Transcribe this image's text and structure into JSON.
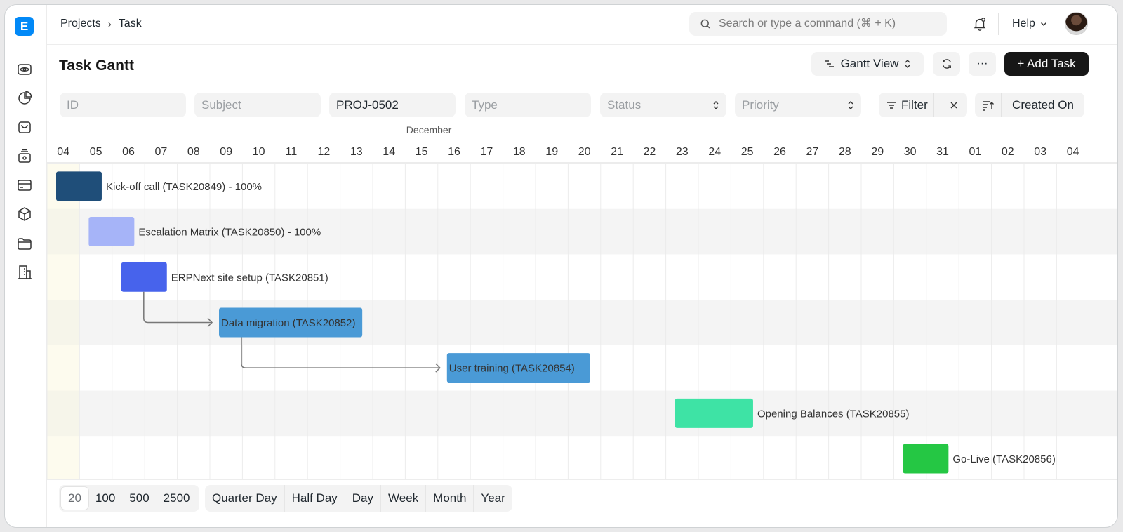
{
  "app": {
    "logo_letter": "E"
  },
  "breadcrumb": [
    "Projects",
    "Task"
  ],
  "search": {
    "placeholder": "Search or type a command (⌘ + K)"
  },
  "topbar": {
    "help_label": "Help"
  },
  "page": {
    "title": "Task Gantt"
  },
  "actions": {
    "view_label": "Gantt View",
    "add_label": "+ Add Task",
    "more_label": "···"
  },
  "filters": {
    "id_placeholder": "ID",
    "subject_placeholder": "Subject",
    "project_value": "PROJ-0502",
    "type_placeholder": "Type",
    "status_placeholder": "Status",
    "priority_placeholder": "Priority",
    "filter_label": "Filter",
    "sort_label": "Created On"
  },
  "gantt": {
    "month_label": "December",
    "days": [
      "04",
      "05",
      "06",
      "07",
      "08",
      "09",
      "10",
      "11",
      "12",
      "13",
      "14",
      "15",
      "16",
      "17",
      "18",
      "19",
      "20",
      "21",
      "22",
      "23",
      "24",
      "25",
      "26",
      "27",
      "28",
      "29",
      "30",
      "31",
      "01",
      "02",
      "03",
      "04"
    ],
    "tasks": [
      {
        "label": "Kick-off call (TASK20849) - 100%",
        "start": 0,
        "span": 1.4,
        "color": "#1f4e79",
        "text_inside": false
      },
      {
        "label": "Escalation Matrix (TASK20850) - 100%",
        "start": 1,
        "span": 1.4,
        "color": "#a6b4f8",
        "text_inside": false
      },
      {
        "label": "ERPNext site setup (TASK20851)",
        "start": 2,
        "span": 1.4,
        "color": "#4763ec",
        "text_inside": false
      },
      {
        "label": "Data migration (TASK20852)",
        "start": 5,
        "span": 4.4,
        "color": "#4a9ad6",
        "text_inside": true
      },
      {
        "label": "User training (TASK20854)",
        "start": 12,
        "span": 4.4,
        "color": "#4a9ad6",
        "text_inside": true
      },
      {
        "label": "Opening Balances (TASK20855)",
        "start": 19,
        "span": 2.4,
        "color": "#3ee3a5",
        "text_inside": false
      },
      {
        "label": "Go-Live (TASK20856)",
        "start": 26,
        "span": 1.4,
        "color": "#25c744",
        "text_inside": false
      }
    ],
    "dependencies": [
      [
        2,
        3
      ],
      [
        3,
        4
      ]
    ]
  },
  "footer": {
    "page_sizes": [
      "20",
      "100",
      "500",
      "2500"
    ],
    "active_page_size": "20",
    "view_modes": [
      "Quarter Day",
      "Half Day",
      "Day",
      "Week",
      "Month",
      "Year"
    ]
  }
}
